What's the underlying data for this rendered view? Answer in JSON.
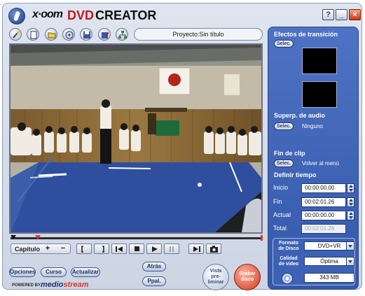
{
  "app": {
    "brand_xoom": "x·oom",
    "brand_dvd": "DVD",
    "brand_creator": "CREATOR",
    "help_glyph": "?",
    "minimize_glyph": "_",
    "close_glyph": "×"
  },
  "project": {
    "title": "Proyecto:Sin título"
  },
  "chapter": {
    "label": "Capítulo",
    "add": "+",
    "remove": "−"
  },
  "buttons": {
    "options": "Opciones",
    "tutorial": "Curso",
    "update": "Actualizar",
    "back": "Atrás",
    "main_menu": "Ppal.",
    "preview_line1": "Vista",
    "preview_line2": "pre-",
    "preview_line3": "liminar",
    "burn_line1": "Grabar",
    "burn_line2": "disco"
  },
  "powered": {
    "powered_by": "POWERED BY",
    "medio": "medio",
    "stream": "stream"
  },
  "panel": {
    "transitions_heading": "Efectos de transición",
    "select_label": "Selec.",
    "audio_heading": "Superp. de audio",
    "audio_value": "Ninguno",
    "clip_end_heading": "Fin de clip",
    "clip_end_value": "Volver al menú",
    "time_heading": "Definir tiempo",
    "start_label": "Inicio",
    "start_value": "00:00:00.00",
    "end_label": "Fin",
    "end_value": "00:02:01.26",
    "current_label": "Actual",
    "current_value": "00:00:00.00",
    "total_label": "Total",
    "total_value": "00:02:01.26",
    "disc_format_label_1": "Formato",
    "disc_format_label_2": "de Disco",
    "disc_format_value": "DVD+VR",
    "video_quality_label_1": "Calidad",
    "video_quality_label_2": "de video",
    "video_quality_value": "Óptima",
    "disc_size": "343 MB"
  },
  "timeline": {
    "position_fraction": 0.1
  },
  "colors": {
    "panel_blue": "#4063b6",
    "brand_red": "#c4171b",
    "burn_red": "#d0371c"
  },
  "icons": [
    "app-logo-icon",
    "wizard-icon",
    "new-project-icon",
    "open-folder-icon",
    "disc-drive-icon",
    "save-icon",
    "save-as-icon",
    "network-icon",
    "mark-in-icon",
    "mark-out-icon",
    "rewind-icon",
    "stop-icon",
    "play-icon",
    "pause-icon",
    "step-forward-icon",
    "snapshot-icon",
    "disc-icon"
  ]
}
